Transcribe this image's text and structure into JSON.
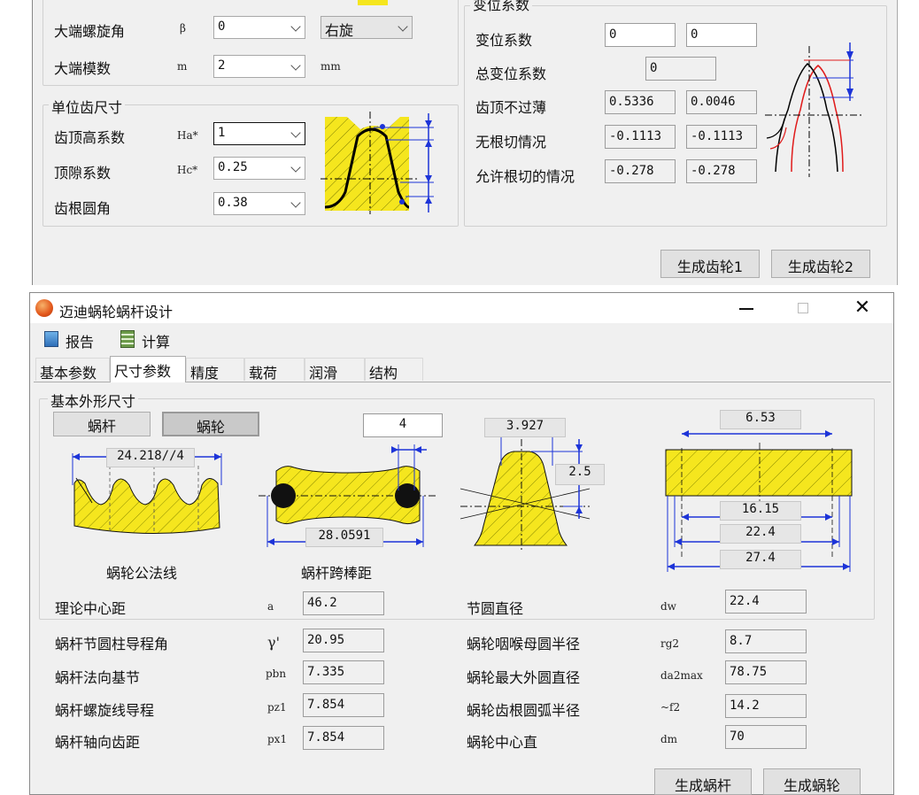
{
  "top": {
    "left_panel": {
      "rows": [
        {
          "label": "大端螺旋角",
          "symbol": "β",
          "value": "0"
        },
        {
          "label": "大端模数",
          "symbol": "m",
          "value": "2",
          "unit": "mm"
        }
      ],
      "direction": "右旋"
    },
    "unit_tooth": {
      "title": "单位齿尺寸",
      "rows": [
        {
          "label": "齿顶高系数",
          "symbol": "Ha*",
          "value": "1"
        },
        {
          "label": "顶隙系数",
          "symbol": "Hc*",
          "value": "0.25"
        },
        {
          "label": "齿根圆角",
          "symbol": "",
          "value": "0.38"
        }
      ]
    },
    "shift": {
      "title": "变位系数",
      "rows": [
        {
          "label": "变位系数",
          "v1": "0",
          "v2": "0"
        },
        {
          "label": "总变位系数",
          "v1": "0",
          "v2": ""
        },
        {
          "label": "齿顶不过薄",
          "v1": "0.5336",
          "v2": "0.0046"
        },
        {
          "label": "无根切情况",
          "v1": "-0.1113",
          "v2": "-0.1113"
        },
        {
          "label": "允许根切的情况",
          "v1": "-0.278",
          "v2": "-0.278"
        }
      ]
    },
    "buttons": {
      "gen1": "生成齿轮1",
      "gen2": "生成齿轮2"
    }
  },
  "window": {
    "title": "迈迪蜗轮蜗杆设计",
    "toolbar": {
      "report": "报告",
      "calc": "计算"
    },
    "tabs": [
      "基本参数",
      "尺寸参数",
      "精度",
      "载荷",
      "润滑",
      "结构"
    ],
    "active_tab": 1,
    "group_title": "基本外形尺寸",
    "toggle": {
      "worm": "蜗杆",
      "wheel": "蜗轮"
    },
    "diagrams": {
      "normal_label": "蜗轮公法线",
      "normal_value": "24.218//4",
      "ball_label": "蜗杆跨棒距",
      "ball_value": "28.0591",
      "ball_top": "4",
      "tooth_top": "3.927",
      "tooth_right": "2.5",
      "rect_top": "6.53",
      "rect_vals": [
        "16.15",
        "22.4",
        "27.4"
      ]
    },
    "params_left": [
      {
        "label": "理论中心距",
        "symbol": "a",
        "value": "46.2"
      },
      {
        "label": "蜗杆节圆柱导程角",
        "symbol": "γ'",
        "value": "20.95"
      },
      {
        "label": "蜗杆法向基节",
        "symbol": "pbn",
        "value": "7.335"
      },
      {
        "label": "蜗杆螺旋线导程",
        "symbol": "pz1",
        "value": "7.854"
      },
      {
        "label": "蜗杆轴向齿距",
        "symbol": "px1",
        "value": "7.854"
      }
    ],
    "params_right": [
      {
        "label": "节圆直径",
        "symbol": "dw",
        "value": "22.4"
      },
      {
        "label": "蜗轮咽喉母圆半径",
        "symbol": "rg2",
        "value": "8.7"
      },
      {
        "label": "蜗轮最大外圆直径",
        "symbol": "da2max",
        "value": "78.75"
      },
      {
        "label": "蜗轮齿根圆弧半径",
        "symbol": "~f2",
        "value": "14.2"
      },
      {
        "label": "蜗轮中心直",
        "symbol": "dm",
        "value": "70"
      }
    ],
    "buttons": {
      "gen_worm": "生成蜗杆",
      "gen_wheel": "生成蜗轮"
    }
  },
  "colors": {
    "fill": "#f5e61e",
    "blue": "#1d34d8",
    "red": "#e01b1b",
    "accent": "#e2561a"
  }
}
